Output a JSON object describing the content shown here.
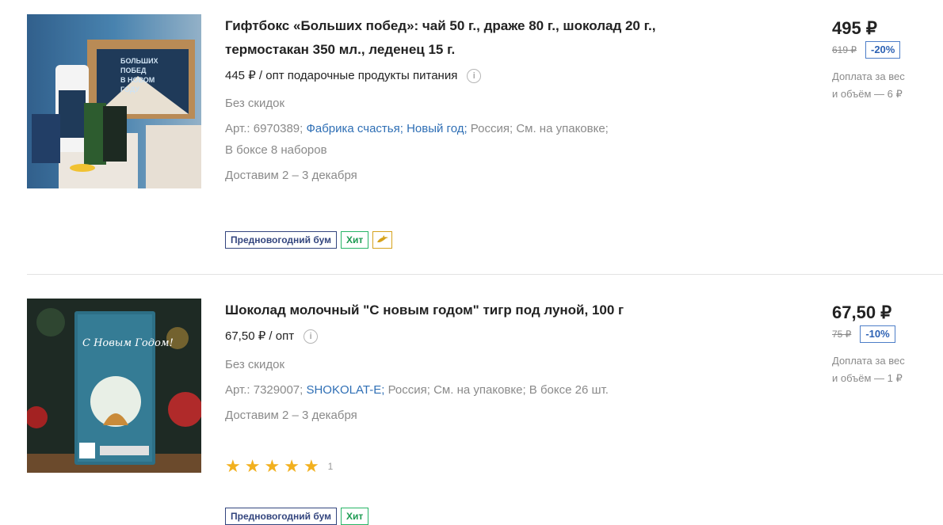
{
  "products": [
    {
      "title_line1": "Гифтбокс «Больших побед»: чай 50 г., драже 80 г., шоколад 20 г.,",
      "title_line2": "термостакан 350 мл., леденец 15 г.",
      "wholesale_price": "445 ₽ / опт подарочные продукты питания",
      "no_discount": "Без скидок",
      "meta_art": "Арт.: 6970389;",
      "meta_brand": "Фабрика счастья;",
      "meta_category": "Новый год;",
      "meta_country": "Россия;",
      "meta_shelf": "См. на упаковке;",
      "meta_box": "В боксе 8 наборов",
      "delivery": "Доставим 2 – 3 декабря",
      "badge_promo": "Предновогодний бум",
      "badge_hit": "Хит",
      "price": "495 ₽",
      "old_price": "619 ₽",
      "discount": "-20%",
      "surcharge_line1": "Доплата за вес",
      "surcharge_line2": "и объём — 6 ₽",
      "image_text": "БОЛЬШИХ ПОБЕД В НОВОМ ГОДУ"
    },
    {
      "title_line1": "Шоколад молочный \"С новым годом\" тигр под луной, 100 г",
      "wholesale_price": "67,50 ₽ / опт",
      "no_discount": "Без скидок",
      "meta_art": "Арт.: 7329007;",
      "meta_brand": "SHOKOLAT-E;",
      "meta_country": "Россия;",
      "meta_shelf": "См. на упаковке;",
      "meta_box": "В боксе 26 шт.",
      "delivery": "Доставим 2 – 3 декабря",
      "rating_count": "1",
      "stars": 5,
      "badge_promo": "Предновогодний бум",
      "badge_hit": "Хит",
      "price": "67,50 ₽",
      "old_price": "75 ₽",
      "discount": "-10%",
      "surcharge_line1": "Доплата за вес",
      "surcharge_line2": "и объём — 1 ₽",
      "image_text": "С Новым Годом!"
    }
  ],
  "colors": {
    "link": "#2f6fb5",
    "promo_badge": "#33457e",
    "hit_badge": "#27b466",
    "discount": "#2d62b4",
    "star": "#f2b01e"
  },
  "icons": [
    "info-icon",
    "dolphin-icon",
    "star-icon"
  ]
}
